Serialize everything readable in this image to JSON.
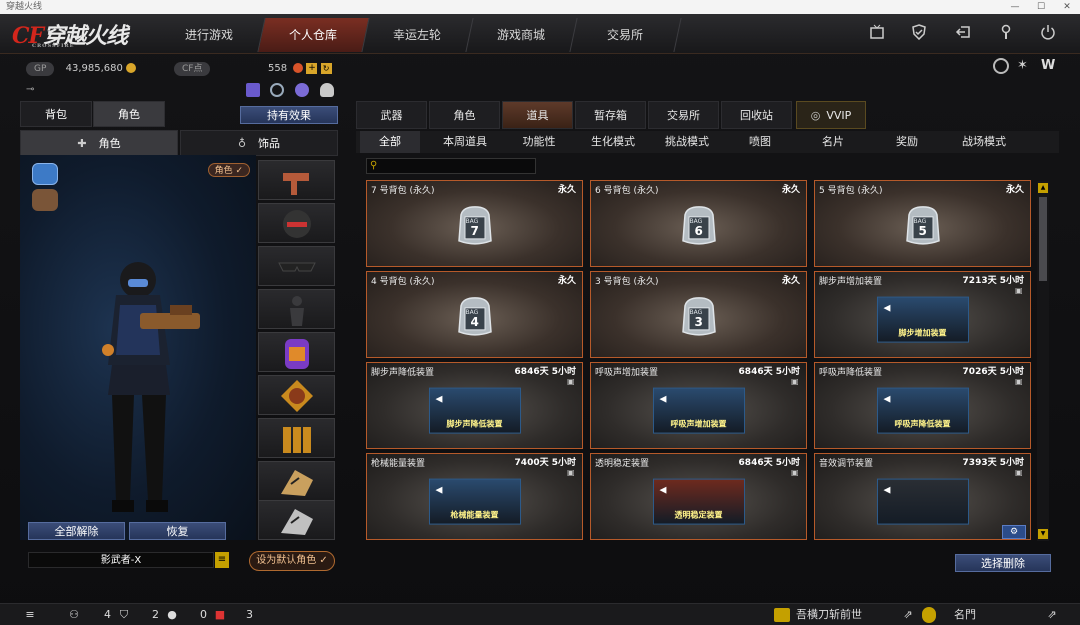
{
  "window": {
    "title": "穿越火线"
  },
  "brand": {
    "logo_cf": "CF",
    "logo_text": "穿越火线",
    "logo_sub": "CROSSFIRE"
  },
  "nav": {
    "items": [
      "进行游戏",
      "个人仓库",
      "幸运左轮",
      "游戏商城",
      "交易所"
    ],
    "active": 1
  },
  "top_icons": [
    "tv-icon",
    "shield-icon",
    "exit-icon",
    "wrench-icon",
    "power-icon"
  ],
  "currency": {
    "gp_label": "GP",
    "gp_value": "43,985,680",
    "cf_label": "CF点",
    "cf_value": "558"
  },
  "left": {
    "tabs": [
      "背包",
      "角色"
    ],
    "effect_button": "持有效果",
    "subtabs": [
      "角色",
      "饰品"
    ],
    "char_badge": "角色 ✓",
    "unequip_all": "全部解除",
    "restore": "恢复",
    "char_name": "影武者-X",
    "set_default": "设为默认角色 ✓"
  },
  "right": {
    "tabs": [
      "武器",
      "角色",
      "道具",
      "暂存箱",
      "交易所",
      "回收站",
      "VVIP"
    ],
    "active_tab": 2,
    "filters": [
      "全部",
      "本周道具",
      "功能性",
      "生化模式",
      "挑战模式",
      "喷图",
      "名片",
      "奖励",
      "战场模式"
    ],
    "active_filter": 0,
    "search_placeholder": "",
    "select_delete": "选择删除"
  },
  "items": [
    {
      "name": "7 号背包 (永久)",
      "time": "永久",
      "kind": "bag",
      "num": "7",
      "tag": "BAG"
    },
    {
      "name": "6 号背包 (永久)",
      "time": "永久",
      "kind": "bag",
      "num": "6",
      "tag": "BAG"
    },
    {
      "name": "5 号背包 (永久)",
      "time": "永久",
      "kind": "bag",
      "num": "5",
      "tag": "BAG"
    },
    {
      "name": "4 号背包 (永久)",
      "time": "永久",
      "kind": "bag",
      "num": "4",
      "tag": "BAG"
    },
    {
      "name": "3 号背包 (永久)",
      "time": "永久",
      "kind": "bag",
      "num": "3",
      "tag": "BAG"
    },
    {
      "name": "脚步声增加装置",
      "time": "7213天 5小时",
      "kind": "banner",
      "label": "脚步增加装置",
      "color": "#2a4a6e"
    },
    {
      "name": "脚步声降低装置",
      "time": "6846天 5小时",
      "kind": "banner",
      "label": "脚步声降低装置",
      "color": "#2a4a6e"
    },
    {
      "name": "呼吸声增加装置",
      "time": "6846天 5小时",
      "kind": "banner",
      "label": "呼吸声增加装置",
      "color": "#2a4a6e"
    },
    {
      "name": "呼吸声降低装置",
      "time": "7026天 5小时",
      "kind": "banner",
      "label": "呼吸声降低装置",
      "color": "#2a4a6e"
    },
    {
      "name": "枪械能量装置",
      "time": "7400天 5小时",
      "kind": "banner",
      "label": "枪械能量装置",
      "color": "#2a4a6e"
    },
    {
      "name": "透明稳定装置",
      "time": "6846天 5小时",
      "kind": "banner",
      "label": "透明稳定装置",
      "color": "#6e2a1e"
    },
    {
      "name": "音效调节装置",
      "time": "7393天 5小时",
      "kind": "banner",
      "label": "",
      "color": "#2a2e34"
    }
  ],
  "bottom": {
    "party_count": "4",
    "shield_count": "2",
    "chat_count": "0",
    "gift_count": "3",
    "chat_player": "吾横刀斩前世",
    "clan": "名門"
  }
}
